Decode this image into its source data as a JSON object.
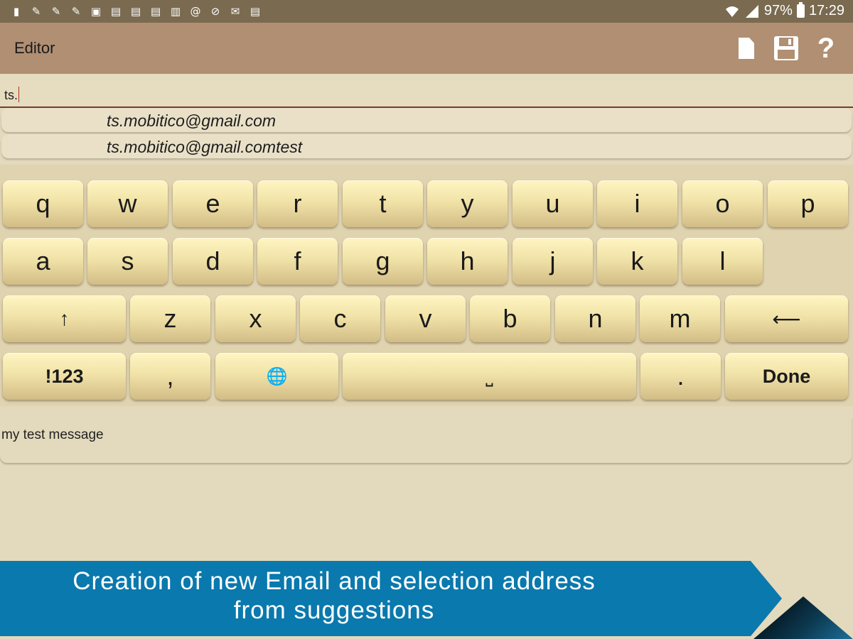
{
  "status_bar": {
    "left_icons": [
      "usb-icon",
      "wrench-icon",
      "wrench-icon",
      "wrench-icon",
      "image-icon",
      "gallery-icon",
      "gallery-icon",
      "gallery-icon",
      "gallery-icon",
      "at-sign-icon",
      "no-sim-icon",
      "mail-icon",
      "gallery-icon"
    ],
    "battery": "97%",
    "time": "17:29"
  },
  "action_bar": {
    "title": "Editor",
    "actions": [
      "new-document-icon",
      "save-icon",
      "help-icon"
    ],
    "help_glyph": "?"
  },
  "compose": {
    "to_value": "ts.",
    "suggestions": [
      "ts.mobitico@gmail.com",
      "ts.mobitico@gmail.comtest"
    ],
    "message": "my test message"
  },
  "keyboard": {
    "row1": [
      "q",
      "w",
      "e",
      "r",
      "t",
      "y",
      "u",
      "i",
      "o",
      "p"
    ],
    "row2": [
      "a",
      "s",
      "d",
      "f",
      "g",
      "h",
      "j",
      "k",
      "l"
    ],
    "row3": [
      "z",
      "x",
      "c",
      "v",
      "b",
      "n",
      "m"
    ],
    "shift_glyph": "↑",
    "backspace_glyph": "⟵",
    "symbols_label": "!123",
    "comma_label": ",",
    "globe_glyph": "🌐",
    "space_glyph": "⎵",
    "period_label": ".",
    "done_label": "Done"
  },
  "banner": {
    "line1": "Creation of new Email and selection address",
    "line2": "from suggestions"
  },
  "colors": {
    "status_bar": "#7a6a50",
    "action_bar": "#b08f73",
    "background": "#e3d9bc",
    "banner": "#0a79ad"
  }
}
